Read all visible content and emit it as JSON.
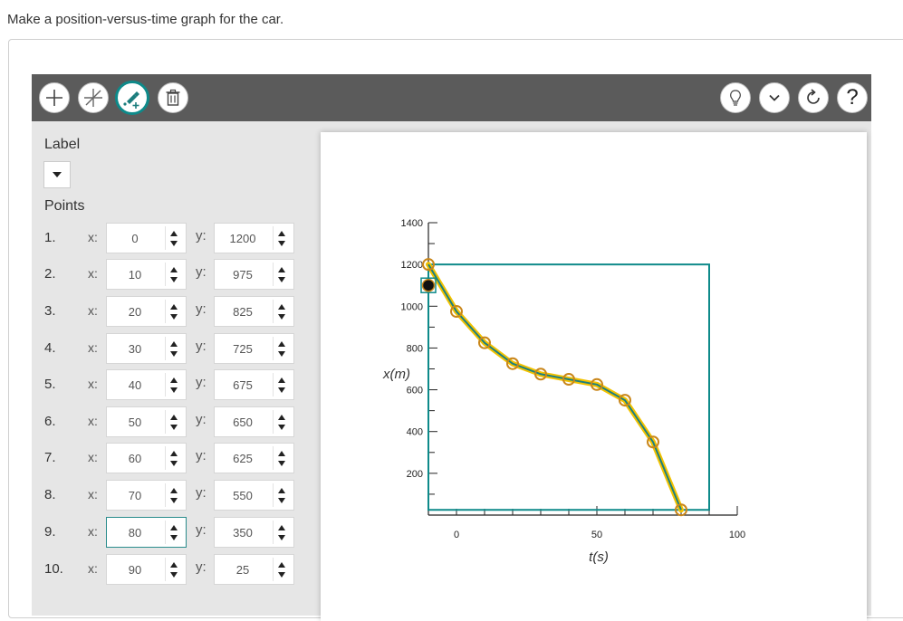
{
  "question": "Make a position-versus-time graph for the car.",
  "toolbar": {
    "left": [
      "add-point-icon",
      "delete-point-icon",
      "draw-line-icon",
      "trash-icon"
    ],
    "right": [
      "lightbulb-icon",
      "chevron-down-icon",
      "refresh-icon",
      "help-icon"
    ],
    "help_glyph": "?"
  },
  "label_heading": "Label",
  "points_heading": "Points",
  "x_label": "x:",
  "y_label": "y:",
  "points": [
    {
      "n": "1.",
      "x": "0",
      "y": "1200"
    },
    {
      "n": "2.",
      "x": "10",
      "y": "975"
    },
    {
      "n": "3.",
      "x": "20",
      "y": "825"
    },
    {
      "n": "4.",
      "x": "30",
      "y": "725"
    },
    {
      "n": "5.",
      "x": "40",
      "y": "675"
    },
    {
      "n": "6.",
      "x": "50",
      "y": "650"
    },
    {
      "n": "7.",
      "x": "60",
      "y": "625"
    },
    {
      "n": "8.",
      "x": "70",
      "y": "550"
    },
    {
      "n": "9.",
      "x": "80",
      "y": "350"
    },
    {
      "n": "10.",
      "x": "90",
      "y": "25"
    }
  ],
  "focused_point_index": 8,
  "colors": {
    "toolbar": "#5b5b5b",
    "teal": "#0e8a8a",
    "curve": "#f2c200",
    "curve_inner": "#1d7f7f",
    "marker": "#c9861a"
  },
  "chart_data": {
    "type": "line",
    "xlabel": "t(s)",
    "ylabel": "x(m)",
    "xlim": [
      -10,
      100
    ],
    "ylim": [
      0,
      1400
    ],
    "x_ticks": [
      0,
      50,
      100
    ],
    "y_ticks": [
      200,
      400,
      600,
      800,
      1000,
      1200,
      1400
    ],
    "x": [
      0,
      10,
      20,
      30,
      40,
      50,
      60,
      70,
      80,
      90
    ],
    "y": [
      1200,
      975,
      825,
      725,
      675,
      650,
      625,
      550,
      350,
      25
    ],
    "bounding_box": {
      "x_range": [
        -10,
        90
      ],
      "y_range": [
        25,
        1200
      ]
    },
    "selected_marker": {
      "x": -10,
      "y": 1100
    }
  }
}
